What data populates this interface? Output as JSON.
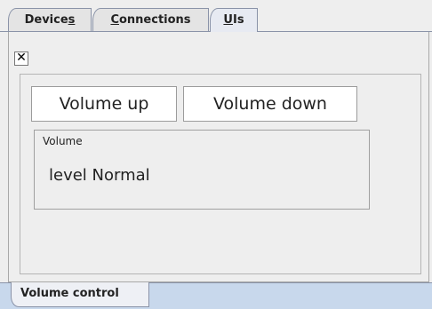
{
  "top_tabs": [
    {
      "pre": "Device",
      "mnemonic": "s",
      "post": "",
      "selected": false
    },
    {
      "pre": "",
      "mnemonic": "C",
      "post": "onnections",
      "selected": false
    },
    {
      "pre": "",
      "mnemonic": "U",
      "post": "Is",
      "selected": true
    }
  ],
  "close_icon": "close-icon",
  "buttons": {
    "volume_up": "Volume up",
    "volume_down": "Volume down"
  },
  "volume_group": {
    "title": "Volume",
    "value": "level Normal"
  },
  "bottom_tabs": [
    {
      "label": "Volume control",
      "selected": true
    }
  ]
}
